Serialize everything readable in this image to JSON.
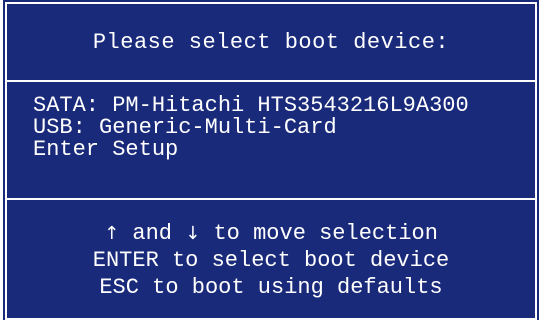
{
  "header": {
    "title": "Please select boot device:"
  },
  "devices": [
    {
      "label": "SATA: PM-Hitachi HTS3543216L9A300"
    },
    {
      "label": "USB: Generic-Multi-Card"
    },
    {
      "label": "Enter Setup"
    }
  ],
  "help": {
    "up_arrow": "↑",
    "and_text": " and ",
    "down_arrow": "↓",
    "move_text": " to move selection",
    "enter_line": "ENTER to select boot device",
    "esc_line": "ESC to boot using defaults"
  },
  "colors": {
    "background": "#1a2a7a",
    "text": "#ffffff",
    "border": "#ffffff"
  }
}
